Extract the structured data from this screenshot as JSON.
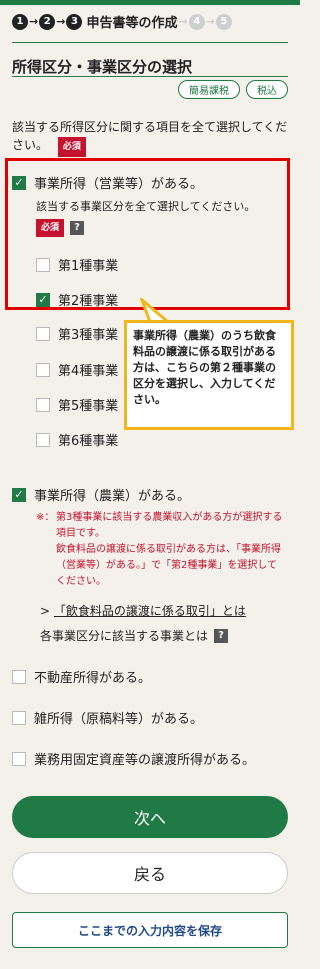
{
  "steps": {
    "s1": "1",
    "s2": "2",
    "s3": "3",
    "s4": "4",
    "s5": "5",
    "title": "申告書等の作成"
  },
  "page": {
    "title": "所得区分・事業区分の選択",
    "pills": [
      "簡易課税",
      "税込"
    ]
  },
  "instruction": {
    "text": "該当する所得区分に関する項目を全て選択してください。",
    "required": "必須"
  },
  "business_income": {
    "label": "事業所得（営業等）がある。",
    "checked": true,
    "sub_instruction": "該当する事業区分を全て選択してください。",
    "required": "必須",
    "help": "?",
    "categories": [
      {
        "label": "第1種事業",
        "checked": false
      },
      {
        "label": "第2種事業",
        "checked": true
      },
      {
        "label": "第3種事業",
        "checked": false
      },
      {
        "label": "第4種事業",
        "checked": false
      },
      {
        "label": "第5種事業",
        "checked": false
      },
      {
        "label": "第6種事業",
        "checked": false
      }
    ]
  },
  "callout": {
    "text": "事業所得（農業）のうち飲食料品の譲渡に係る取引がある方は、こちらの第２種事業の区分を選択し、入力してください。"
  },
  "agri_income": {
    "label": "事業所得（農業）がある。",
    "checked": true,
    "note_mark": "※：",
    "note_line1": "第3種事業に該当する農業収入がある方が選択する項目です。",
    "note_line2": "飲食料品の譲渡に係る取引がある方は、「事業所得（営業等）がある。」で「第2種事業」を選択してください。"
  },
  "link": {
    "chevron": ">",
    "text": "「飲食料品の譲渡に係る取引」とは"
  },
  "kubun_help": {
    "text": "各事業区分に該当する事業とは",
    "help": "?"
  },
  "other_incomes": [
    {
      "label": "不動産所得がある。",
      "checked": false
    },
    {
      "label": "雑所得（原稿料等）がある。",
      "checked": false
    },
    {
      "label": "業務用固定資産等の譲渡所得がある。",
      "checked": false
    }
  ],
  "buttons": {
    "next": "次へ",
    "back": "戻る",
    "save": "ここまでの入力内容を保存"
  },
  "colors": {
    "accent": "#1f7a45",
    "required": "#c4122f",
    "highlight_box": "#e00000",
    "callout_border": "#f2b81a"
  }
}
